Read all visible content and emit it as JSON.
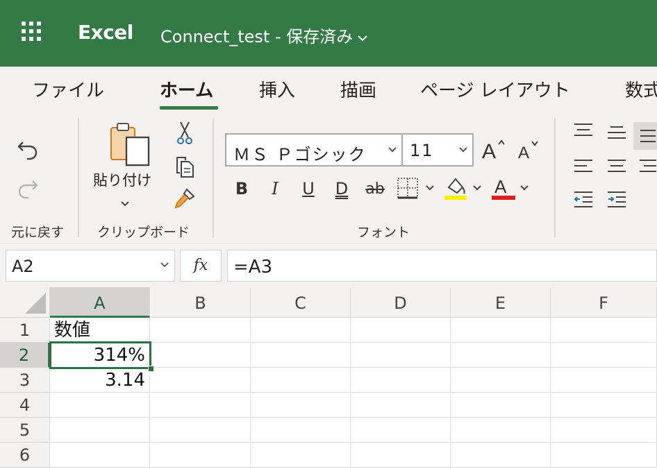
{
  "app": {
    "name": "Excel",
    "document_title": "Connect_test - 保存済み",
    "accent_color": "#337a46"
  },
  "ribbon_tabs": [
    {
      "label": "ファイル"
    },
    {
      "label": "ホーム",
      "active": true
    },
    {
      "label": "挿入"
    },
    {
      "label": "描画"
    },
    {
      "label": "ページ レイアウト"
    },
    {
      "label": "数式"
    }
  ],
  "groups": {
    "undo": {
      "label": "元に戻す"
    },
    "clipboard": {
      "label": "クリップボード",
      "paste_label": "貼り付け"
    },
    "font": {
      "label": "フォント",
      "font_name": "ＭＳ Ｐゴシック",
      "font_size": "11",
      "fill_color": "#fff200",
      "font_color": "#e02020"
    }
  },
  "format_buttons": {
    "bold": "B",
    "italic": "I",
    "underline": "U",
    "double_underline": "D",
    "strike": "ab",
    "font_color_letter": "A"
  },
  "formula_bar": {
    "name_box": "A2",
    "fx_label": "fx",
    "formula": "=A3"
  },
  "grid": {
    "columns": [
      "A",
      "B",
      "C",
      "D",
      "E",
      "F"
    ],
    "rows": [
      "1",
      "2",
      "3",
      "4",
      "5",
      "6"
    ],
    "active_column": "A",
    "active_row": "2",
    "selected_cell": "A2",
    "cells": {
      "A1": "数値",
      "A2": "314%",
      "A3": "3.14"
    }
  }
}
